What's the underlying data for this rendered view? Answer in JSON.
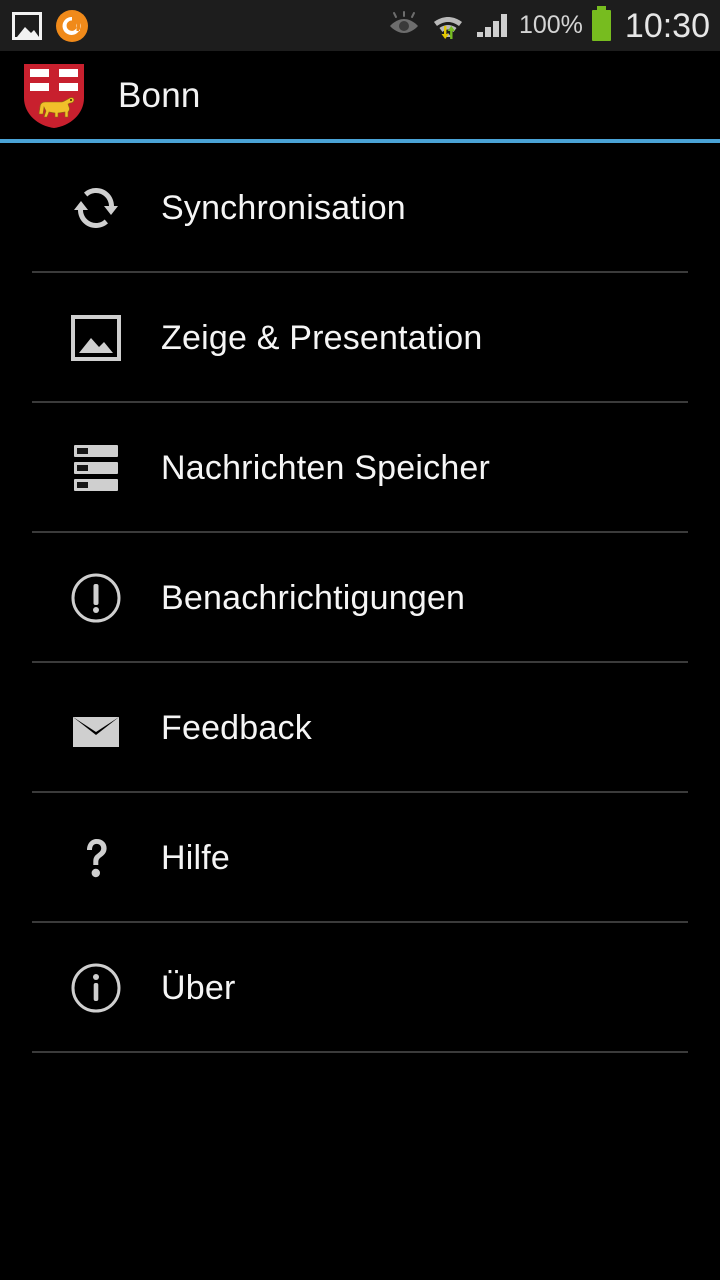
{
  "status_bar": {
    "notifications": [
      {
        "name": "photo-notification-icon",
        "label": "photo-icon"
      },
      {
        "name": "app-notification-icon",
        "label": "orange-app-icon"
      }
    ],
    "smart_stay_icon": "eye-icon",
    "wifi_icon": "wifi-icon",
    "data_transfer_icon": "up-down-arrows-icon",
    "signal_icon": "signal-bars-icon",
    "battery_percent": "100%",
    "battery_icon": "battery-full-icon",
    "clock": "10:30",
    "colors": {
      "background": "#1d1d1d",
      "battery": "#77bc1f",
      "text": "#d4d4d4"
    }
  },
  "action_bar": {
    "logo_icon": "bonn-coat-of-arms-icon",
    "title": "Bonn",
    "accent_color": "#4aa3d6"
  },
  "menu": {
    "items": [
      {
        "id": "synchronisation",
        "label": "Synchronisation",
        "icon": "sync-icon"
      },
      {
        "id": "zeige-presentation",
        "label": "Zeige & Presentation",
        "icon": "image-icon"
      },
      {
        "id": "nachrichten-speicher",
        "label": "Nachrichten Speicher",
        "icon": "storage-icon"
      },
      {
        "id": "benachrichtigungen",
        "label": "Benachrichtigungen",
        "icon": "alert-circle-icon"
      },
      {
        "id": "feedback",
        "label": "Feedback",
        "icon": "mail-icon"
      },
      {
        "id": "hilfe",
        "label": "Hilfe",
        "icon": "question-mark-icon"
      },
      {
        "id": "ueber",
        "label": "Über",
        "icon": "info-circle-icon"
      }
    ],
    "colors": {
      "background": "#000000",
      "label": "#f5f5f5",
      "icon": "#cfcfcf",
      "divider": "#3b3b3b"
    }
  }
}
